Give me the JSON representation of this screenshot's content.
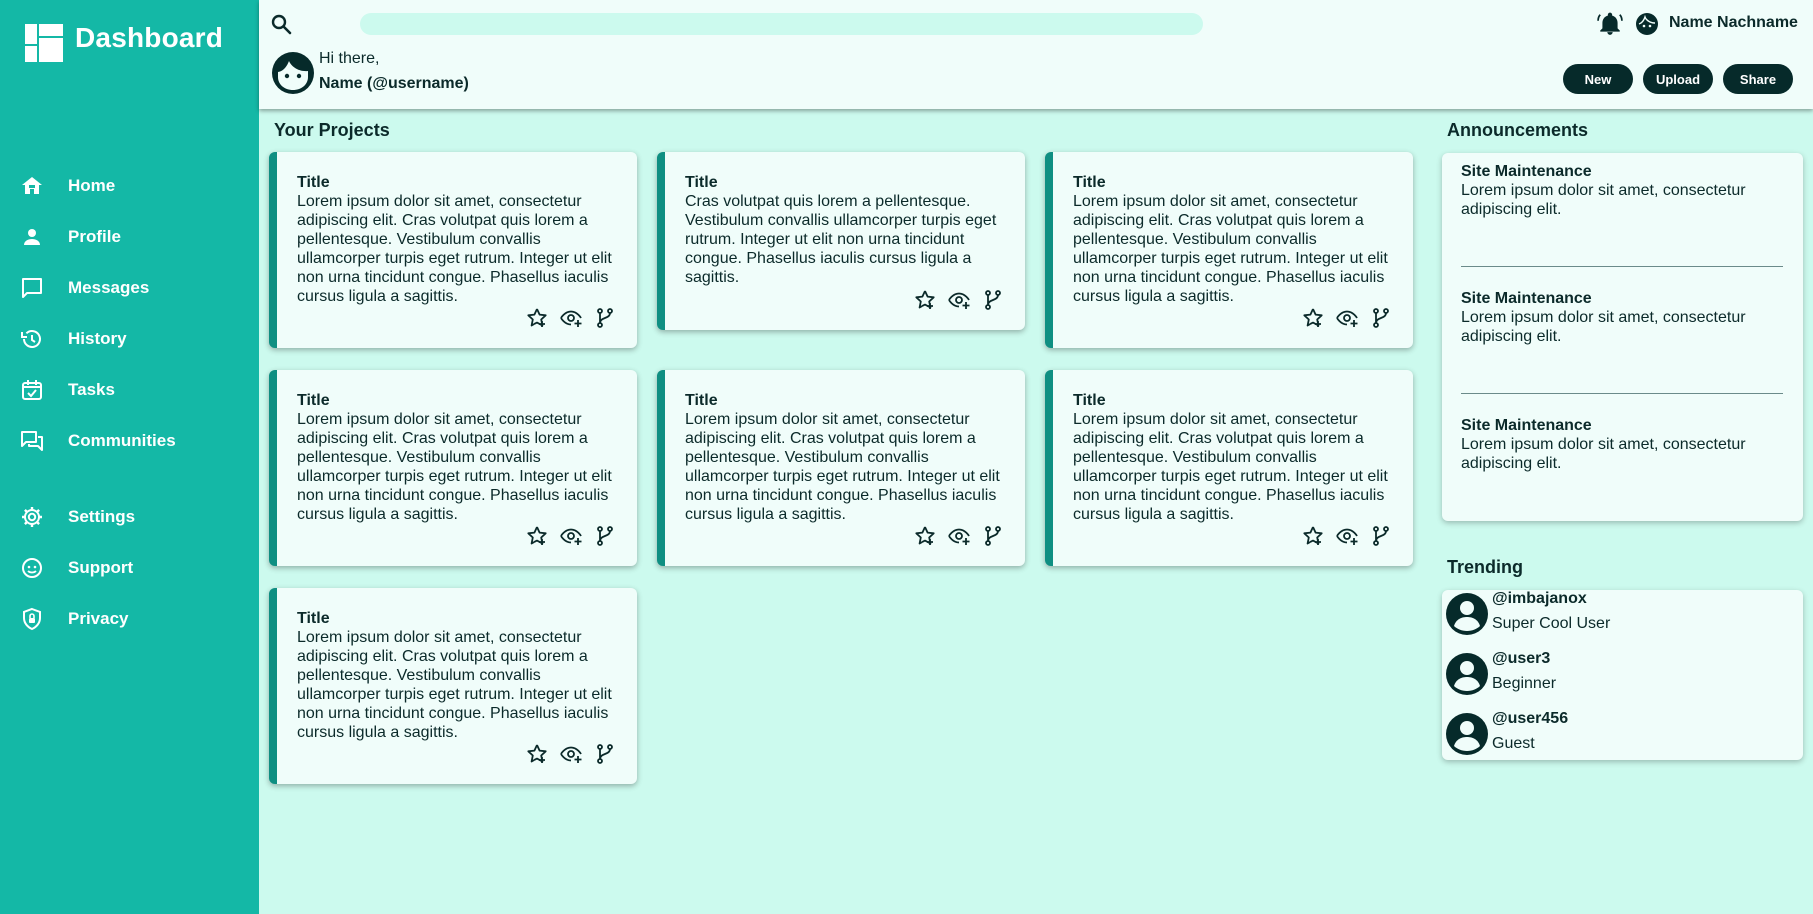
{
  "brand": {
    "title": "Dashboard"
  },
  "sidebar": {
    "items": [
      {
        "label": "Home",
        "icon": "home-icon"
      },
      {
        "label": "Profile",
        "icon": "profile-icon"
      },
      {
        "label": "Messages",
        "icon": "messages-icon"
      },
      {
        "label": "History",
        "icon": "history-icon"
      },
      {
        "label": "Tasks",
        "icon": "tasks-icon"
      },
      {
        "label": "Communities",
        "icon": "communities-icon"
      },
      {
        "label": "Settings",
        "icon": "gear-icon"
      },
      {
        "label": "Support",
        "icon": "support-icon"
      },
      {
        "label": "Privacy",
        "icon": "shield-icon"
      }
    ]
  },
  "header": {
    "search_placeholder": "",
    "user_name": "Name Nachname",
    "greeting": "Hi there,",
    "greeting_name": "Name (@username)",
    "buttons": {
      "new": "New",
      "upload": "Upload",
      "share": "Share"
    }
  },
  "projects": {
    "heading": "Your Projects",
    "cards": [
      {
        "title": "Title",
        "body": "Lorem ipsum dolor sit amet, consectetur adipiscing elit. Cras volutpat quis lorem a pellentesque. Vestibulum convallis ullamcorper turpis eget rutrum. Integer ut elit non urna tincidunt congue. Phasellus iaculis cursus ligula a sagittis."
      },
      {
        "title": "Title",
        "body": "Cras volutpat quis lorem a pellentesque. Vestibulum convallis ullamcorper turpis eget rutrum. Integer ut elit non urna tincidunt congue. Phasellus iaculis cursus ligula a sagittis."
      },
      {
        "title": "Title",
        "body": "Lorem ipsum dolor sit amet, consectetur adipiscing elit. Cras volutpat quis lorem a pellentesque. Vestibulum convallis ullamcorper turpis eget rutrum. Integer ut elit non urna tincidunt congue. Phasellus iaculis cursus ligula a sagittis."
      },
      {
        "title": "Title",
        "body": "Lorem ipsum dolor sit amet, consectetur adipiscing elit. Cras volutpat quis lorem a pellentesque. Vestibulum convallis ullamcorper turpis eget rutrum. Integer ut elit non urna tincidunt congue. Phasellus iaculis cursus ligula a sagittis."
      },
      {
        "title": "Title",
        "body": "Lorem ipsum dolor sit amet, consectetur adipiscing elit. Cras volutpat quis lorem a pellentesque. Vestibulum convallis ullamcorper turpis eget rutrum. Integer ut elit non urna tincidunt congue. Phasellus iaculis cursus ligula a sagittis."
      },
      {
        "title": "Title",
        "body": "Lorem ipsum dolor sit amet, consectetur adipiscing elit. Cras volutpat quis lorem a pellentesque. Vestibulum convallis ullamcorper turpis eget rutrum. Integer ut elit non urna tincidunt congue. Phasellus iaculis cursus ligula a sagittis."
      },
      {
        "title": "Title",
        "body": "Lorem ipsum dolor sit amet, consectetur adipiscing elit. Cras volutpat quis lorem a pellentesque. Vestibulum convallis ullamcorper turpis eget rutrum. Integer ut elit non urna tincidunt congue. Phasellus iaculis cursus ligula a sagittis."
      }
    ]
  },
  "announcements": {
    "heading": "Announcements",
    "items": [
      {
        "title": "Site Maintenance",
        "body": "Lorem ipsum dolor sit amet, consectetur adipiscing elit."
      },
      {
        "title": "Site Maintenance",
        "body": "Lorem ipsum dolor sit amet, consectetur adipiscing elit."
      },
      {
        "title": "Site Maintenance",
        "body": "Lorem ipsum dolor sit amet, consectetur adipiscing elit."
      }
    ]
  },
  "trending": {
    "heading": "Trending",
    "users": [
      {
        "handle": "@imbajanox",
        "role": "Super Cool User"
      },
      {
        "handle": "@user3",
        "role": "Beginner"
      },
      {
        "handle": "@user456",
        "role": "Guest"
      }
    ]
  },
  "colors": {
    "sidebar": "#14b8a6",
    "background": "#ccfaee",
    "surface": "#f0fdfa",
    "accent_border": "#0f8f82",
    "dark": "#062a2a"
  }
}
